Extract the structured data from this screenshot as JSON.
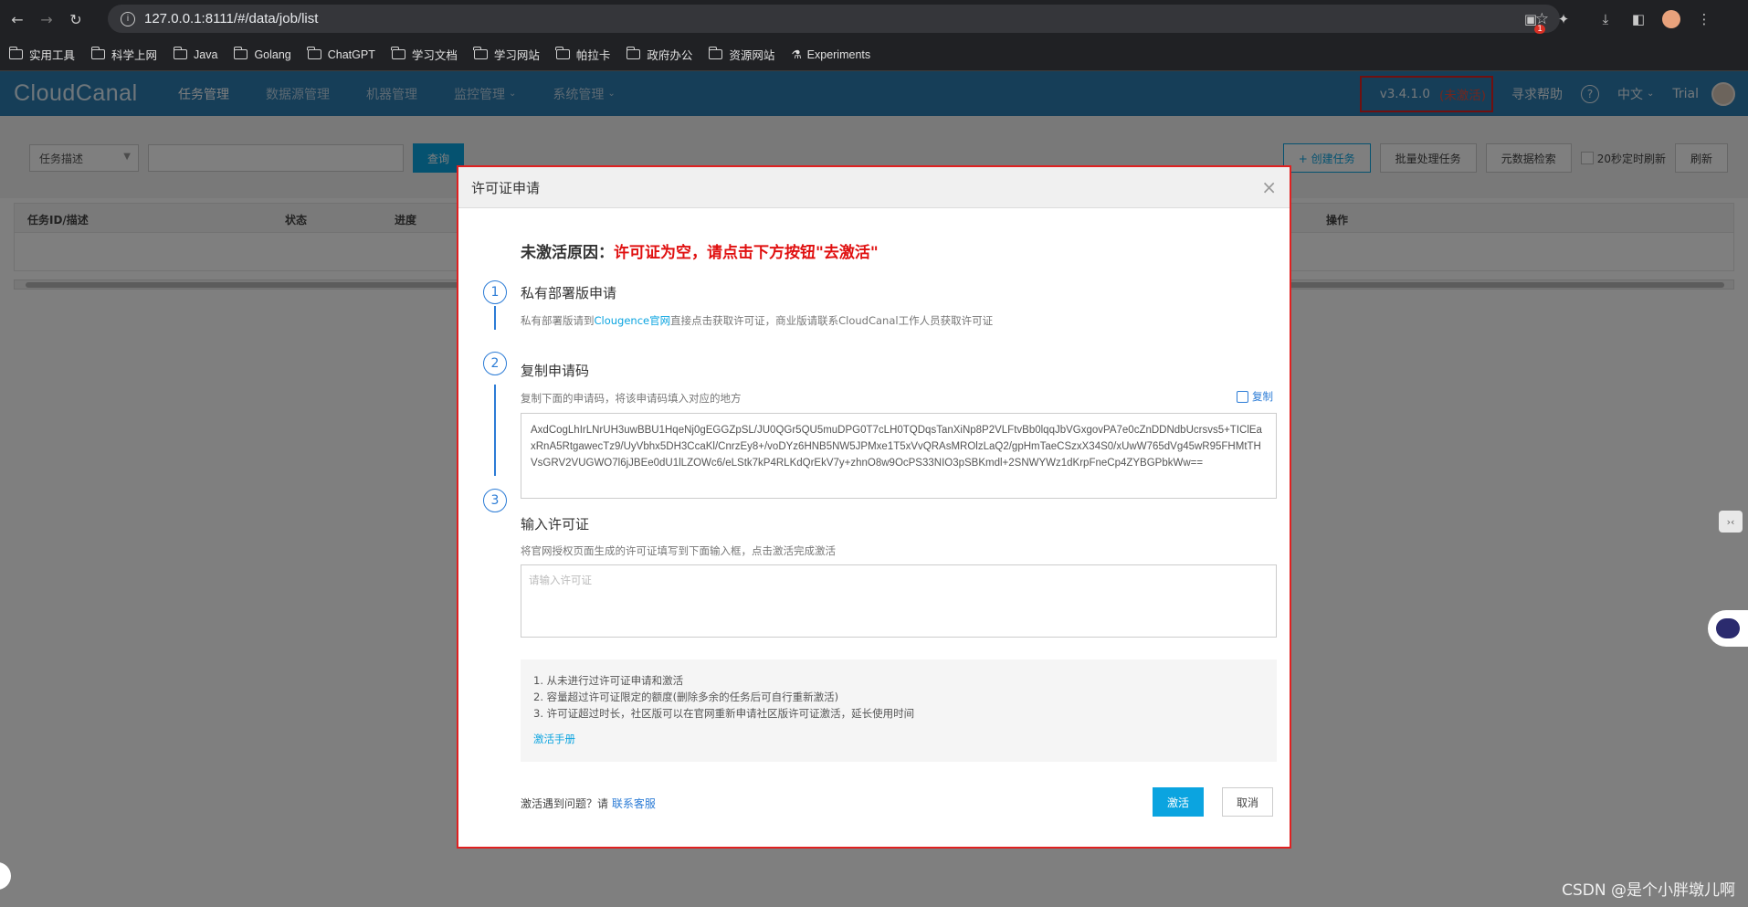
{
  "browser": {
    "url": "127.0.0.1:8111/#/data/job/list",
    "extension_badge": "1",
    "bookmarks": [
      "实用工具",
      "科学上网",
      "Java",
      "Golang",
      "ChatGPT",
      "学习文档",
      "学习网站",
      "帕拉卡",
      "政府办公",
      "资源网站",
      "Experiments"
    ]
  },
  "app": {
    "logo": "CloudCanal",
    "menu": [
      {
        "label": "任务管理",
        "dropdown": false
      },
      {
        "label": "数据源管理",
        "dropdown": false
      },
      {
        "label": "机器管理",
        "dropdown": false
      },
      {
        "label": "监控管理",
        "dropdown": true
      },
      {
        "label": "系统管理",
        "dropdown": true
      }
    ],
    "version": "v3.4.1.0",
    "version_status": "未激活",
    "help_label": "寻求帮助",
    "language": "中文",
    "plan": "Trial"
  },
  "toolbar": {
    "filter_select": "任务描述",
    "query_label": "查询",
    "create_label": "+ 创建任务",
    "batch_label": "批量处理任务",
    "metadata_label": "元数据检索",
    "auto_refresh_label": "20秒定时刷新",
    "refresh_label": "刷新"
  },
  "table": {
    "columns": [
      "任务ID/描述",
      "状态",
      "进度",
      "操作"
    ]
  },
  "modal": {
    "title": "许可证申请",
    "reason_label": "未激活原因：",
    "reason_text": "许可证为空，请点击下方按钮\"去激活\"",
    "steps": [
      {
        "num": "1",
        "title": "私有部署版申请",
        "desc_pre": "私有部署版请到",
        "desc_link": "Clougence官网",
        "desc_post": "直接点击获取许可证，商业版请联系CloudCanal工作人员获取许可证"
      },
      {
        "num": "2",
        "title": "复制申请码",
        "desc": "复制下面的申请码，将该申请码填入对应的地方"
      },
      {
        "num": "3",
        "title": "输入许可证",
        "desc": "将官网授权页面生成的许可证填写到下面输入框，点击激活完成激活"
      }
    ],
    "copy_label": "复制",
    "apply_code": "AxdCogLhIrLNrUH3uwBBU1HqeNj0gEGGZpSL/JU0QGr5QU5muDPG0T7cLH0TQDqsTanXiNp8P2VLFtvBb0lqqJbVGxgovPA7e0cZnDDNdbUcrsvs5+TIClEaxRnA5RtgawecTz9/UyVbhx5DH3CcaKl/CnrzEy8+/voDYz6HNB5NW5JPMxe1T5xVvQRAsMROlzLaQ2/gpHmTaeCSzxX34S0/xUwW765dVg45wR95FHMtTHVsGRV2VUGWO7l6jJBEe0dU1lLZOWc6/eLStk7kP4RLKdQrEkV7y+zhnO8w9OcPS33NIO3pSBKmdl+2SNWYWz1dKrpFneCp4ZYBGPbkWw==",
    "license_placeholder": "请输入许可证",
    "notes": [
      "1. 从未进行过许可证申请和激活",
      "2. 容量超过许可证限定的额度(删除多余的任务后可自行重新激活)",
      "3. 许可证超过时长，社区版可以在官网重新申请社区版许可证激活，延长使用时间"
    ],
    "manual_label": "激活手册",
    "footer_pre": "激活遇到问题？请",
    "footer_link": "联系客服",
    "activate_label": "激活",
    "cancel_label": "取消"
  },
  "watermark": "CSDN @是个小胖墩儿啊"
}
